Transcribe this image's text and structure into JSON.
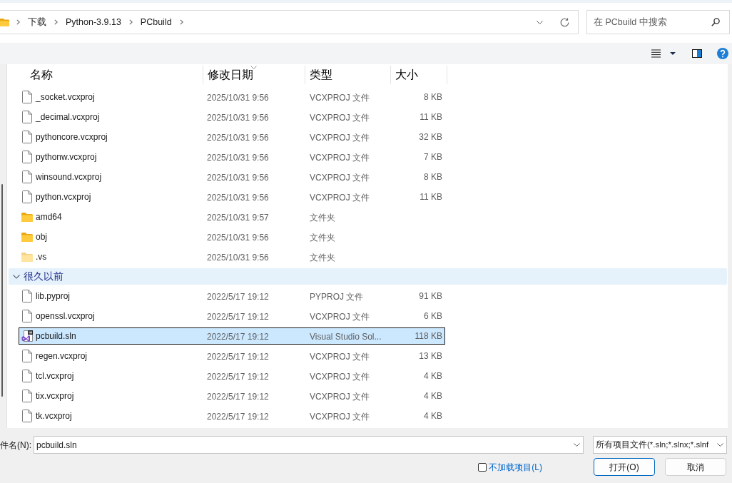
{
  "address_bar": {
    "breadcrumbs": [
      "下载",
      "Python-3.9.13",
      "PCbuild"
    ]
  },
  "search": {
    "placeholder": "在 PCbuild 中搜索"
  },
  "file_list": {
    "columns": [
      {
        "label": "名称",
        "sorted": false
      },
      {
        "label": "修改日期",
        "sorted": true
      },
      {
        "label": "类型",
        "sorted": false
      },
      {
        "label": "大小",
        "sorted": false
      }
    ],
    "groups": [
      {
        "rows": [
          {
            "kind": "file",
            "name": "_socket.vcxproj",
            "modified": "2025/10/31 9:56",
            "type": "VCXPROJ 文件",
            "size": "8 KB",
            "selected": false,
            "hidden": false
          },
          {
            "kind": "file",
            "name": "_decimal.vcxproj",
            "modified": "2025/10/31 9:56",
            "type": "VCXPROJ 文件",
            "size": "11 KB",
            "selected": false,
            "hidden": false
          },
          {
            "kind": "file",
            "name": "pythoncore.vcxproj",
            "modified": "2025/10/31 9:56",
            "type": "VCXPROJ 文件",
            "size": "32 KB",
            "selected": false,
            "hidden": false
          },
          {
            "kind": "file",
            "name": "pythonw.vcxproj",
            "modified": "2025/10/31 9:56",
            "type": "VCXPROJ 文件",
            "size": "7 KB",
            "selected": false,
            "hidden": false
          },
          {
            "kind": "file",
            "name": "winsound.vcxproj",
            "modified": "2025/10/31 9:56",
            "type": "VCXPROJ 文件",
            "size": "8 KB",
            "selected": false,
            "hidden": false
          },
          {
            "kind": "file",
            "name": "python.vcxproj",
            "modified": "2025/10/31 9:56",
            "type": "VCXPROJ 文件",
            "size": "11 KB",
            "selected": false,
            "hidden": false
          },
          {
            "kind": "folder",
            "name": "amd64",
            "modified": "2025/10/31 9:57",
            "type": "文件夹",
            "selected": false,
            "hidden": false
          },
          {
            "kind": "folder",
            "name": "obj",
            "modified": "2025/10/31 9:56",
            "type": "文件夹",
            "selected": false,
            "hidden": false
          },
          {
            "kind": "folder",
            "name": ".vs",
            "modified": "2025/10/31 9:56",
            "type": "文件夹",
            "selected": false,
            "hidden": true
          }
        ]
      },
      {
        "label": "很久以前",
        "expanded": true,
        "rows": [
          {
            "kind": "file",
            "name": "lib.pyproj",
            "modified": "2022/5/17 19:12",
            "type": "PYPROJ 文件",
            "size": "91 KB",
            "selected": false,
            "hidden": false
          },
          {
            "kind": "file",
            "name": "openssl.vcxproj",
            "modified": "2022/5/17 19:12",
            "type": "VCXPROJ 文件",
            "size": "6 KB",
            "selected": false,
            "hidden": false
          },
          {
            "kind": "solution",
            "name": "pcbuild.sln",
            "modified": "2022/5/17 19:12",
            "type": "Visual Studio Sol...",
            "size": "118 KB",
            "selected": true,
            "hidden": false
          },
          {
            "kind": "file",
            "name": "regen.vcxproj",
            "modified": "2022/5/17 19:12",
            "type": "VCXPROJ 文件",
            "size": "13 KB",
            "selected": false,
            "hidden": false
          },
          {
            "kind": "file",
            "name": "tcl.vcxproj",
            "modified": "2022/5/17 19:12",
            "type": "VCXPROJ 文件",
            "size": "4 KB",
            "selected": false,
            "hidden": false
          },
          {
            "kind": "file",
            "name": "tix.vcxproj",
            "modified": "2022/5/17 19:12",
            "type": "VCXPROJ 文件",
            "size": "4 KB",
            "selected": false,
            "hidden": false
          },
          {
            "kind": "file",
            "name": "tk.vcxproj",
            "modified": "2022/5/17 19:12",
            "type": "VCXPROJ 文件",
            "size": "4 KB",
            "selected": false,
            "hidden": false
          }
        ]
      }
    ]
  },
  "file_name": {
    "label": "件名(N):",
    "value": "pcbuild.sln"
  },
  "file_type": {
    "value": "所有项目文件(*.sln;*.slnx;*.slnf"
  },
  "options": [
    {
      "label": "不加载项目(L)",
      "checked": false
    }
  ],
  "buttons": [
    {
      "label": "打开(O)",
      "default": true
    },
    {
      "label": "取消",
      "default": false
    }
  ]
}
